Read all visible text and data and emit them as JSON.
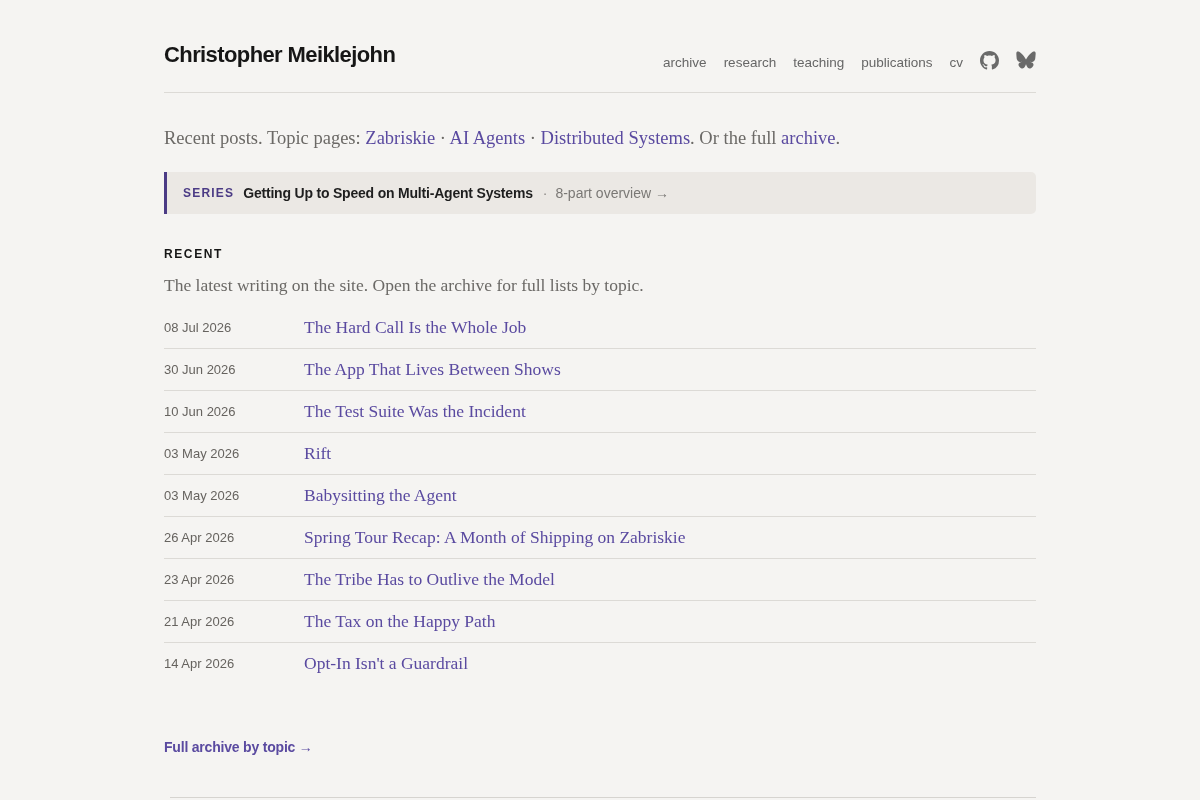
{
  "header": {
    "title": "Christopher Meiklejohn",
    "nav": [
      {
        "label": "archive"
      },
      {
        "label": "research"
      },
      {
        "label": "teaching"
      },
      {
        "label": "publications"
      },
      {
        "label": "cv"
      }
    ]
  },
  "intro": [
    {
      "kind": "text",
      "text": "Recent posts. Topic pages: "
    },
    {
      "kind": "link",
      "text": "Zabriskie"
    },
    {
      "kind": "text",
      "text": " · "
    },
    {
      "kind": "link",
      "text": "AI Agents"
    },
    {
      "kind": "text",
      "text": " · "
    },
    {
      "kind": "link",
      "text": "Distributed Systems"
    },
    {
      "kind": "text",
      "text": ". Or the full "
    },
    {
      "kind": "link",
      "text": "archive"
    },
    {
      "kind": "text",
      "text": "."
    }
  ],
  "series": {
    "label": "SERIES",
    "title": "Getting Up to Speed on Multi-Agent Systems",
    "separator": "·",
    "overview": "8-part overview →"
  },
  "recent": {
    "heading": "RECENT",
    "description": "The latest writing on the site. Open the archive for full lists by topic.",
    "posts": [
      {
        "date": "08 Jul 2026",
        "title": "The Hard Call Is the Whole Job"
      },
      {
        "date": "30 Jun 2026",
        "title": "The App That Lives Between Shows"
      },
      {
        "date": "10 Jun 2026",
        "title": "The Test Suite Was the Incident"
      },
      {
        "date": "03 May 2026",
        "title": "Rift"
      },
      {
        "date": "03 May 2026",
        "title": "Babysitting the Agent"
      },
      {
        "date": "26 Apr 2026",
        "title": "Spring Tour Recap: A Month of Shipping on Zabriskie"
      },
      {
        "date": "23 Apr 2026",
        "title": "The Tribe Has to Outlive the Model"
      },
      {
        "date": "21 Apr 2026",
        "title": "The Tax on the Happy Path"
      },
      {
        "date": "14 Apr 2026",
        "title": "Opt-In Isn't a Guardrail"
      }
    ]
  },
  "footer_link": "Full archive by topic →"
}
